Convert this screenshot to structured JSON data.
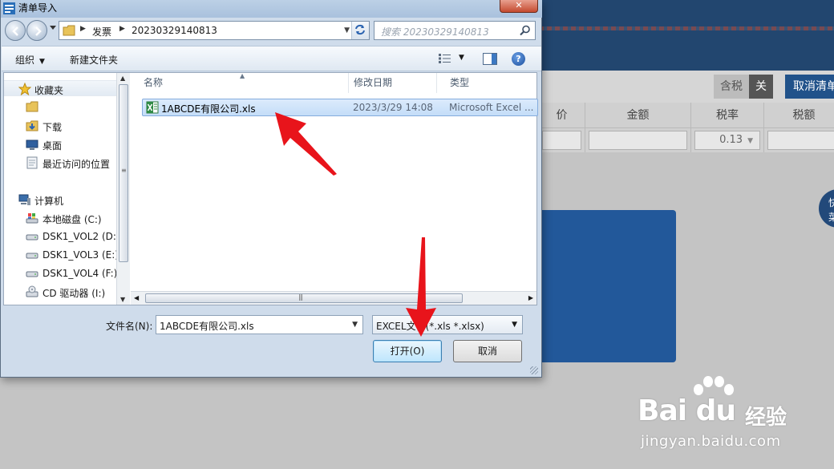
{
  "background_app": {
    "toolbar": {
      "tax_included_label": "含税",
      "off_label": "关",
      "cancel_button_label": "取消清单"
    },
    "table": {
      "columns": [
        "价",
        "金额",
        "税率",
        "税额"
      ],
      "tax_rate_value": "0.13"
    },
    "floating_button_text": "快\n菜"
  },
  "dialog": {
    "title": "清单导入",
    "close_label": "✕",
    "address": {
      "segments": [
        "发票",
        "20230329140813"
      ]
    },
    "search": {
      "placeholder": "搜索 20230329140813"
    },
    "commands": {
      "organize": "组织",
      "new_folder": "新建文件夹"
    },
    "nav": {
      "favorites": "收藏夹",
      "favorite_items": [
        "",
        "下载",
        "桌面",
        "最近访问的位置"
      ],
      "computer": "计算机",
      "drives": [
        "本地磁盘 (C:)",
        "DSK1_VOL2 (D:)",
        "DSK1_VOL3 (E:)",
        "DSK1_VOL4 (F:)",
        "CD 驱动器 (I:)"
      ]
    },
    "columns": {
      "name": "名称",
      "modified": "修改日期",
      "type": "类型"
    },
    "files": [
      {
        "name": "1ABCDE有限公司.xls",
        "modified": "2023/3/29 14:08",
        "type": "Microsoft Excel ..."
      }
    ],
    "filename": {
      "label": "文件名(N):",
      "value": "1ABCDE有限公司.xls"
    },
    "filetype": {
      "value": "EXCEL文件(*.xls *.xlsx)"
    },
    "buttons": {
      "open": "打开(O)",
      "cancel": "取消"
    }
  },
  "watermark": {
    "brand": "Bai du",
    "product": "经验",
    "url": "jingyan.baidu.com"
  },
  "colors": {
    "app_header": "#22466f",
    "accent_blue": "#21528a",
    "annotation_arrow": "#e8141b",
    "selection": "#c4ddf8"
  }
}
